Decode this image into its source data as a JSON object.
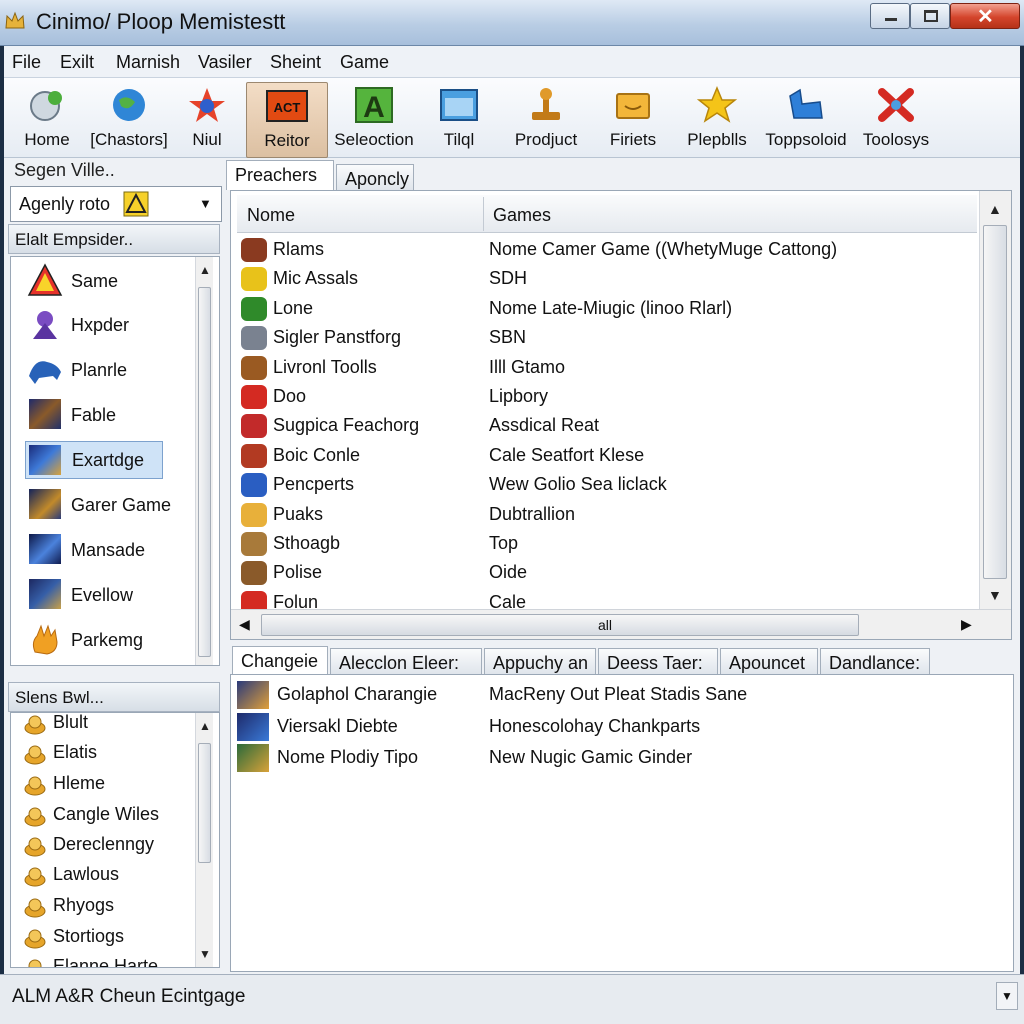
{
  "window": {
    "title": "Cinimo/ Ploop Memistestt"
  },
  "menu": [
    "File",
    "Exilt",
    "Marnish",
    "Vasiler",
    "Sheint",
    "Game"
  ],
  "toolbar": [
    {
      "label": "Home",
      "icon": "home-globe-icon"
    },
    {
      "label": "[Chastors]",
      "icon": "globe-icon"
    },
    {
      "label": "Niul",
      "icon": "puzzle-star-icon"
    },
    {
      "label": "Reitor",
      "icon": "act-icon",
      "active": true
    },
    {
      "label": "Seleoction",
      "icon": "a-letter-icon"
    },
    {
      "label": "Tilql",
      "icon": "window-icon"
    },
    {
      "label": "Prodjuct",
      "icon": "joystick-icon"
    },
    {
      "label": "Firiets",
      "icon": "folder-icon"
    },
    {
      "label": "Plepblls",
      "icon": "star-icon"
    },
    {
      "label": "Toppsoloid",
      "icon": "blue-shape-icon"
    },
    {
      "label": "Toolosys",
      "icon": "red-x-icon"
    }
  ],
  "left": {
    "search_label": "Segen Ville..",
    "dropdown_value": "Agenly roto",
    "section1_title": "Elalt Empsider..",
    "items1": [
      {
        "label": "Same",
        "icon": "warning-icon"
      },
      {
        "label": "Hxpder",
        "icon": "creature-icon"
      },
      {
        "label": "Planrle",
        "icon": "animal-icon"
      },
      {
        "label": "Fable",
        "icon": "game-thumb-icon"
      },
      {
        "label": "Exartdge",
        "icon": "game-thumb-icon",
        "selected": true
      },
      {
        "label": "Garer Game",
        "icon": "game-thumb-icon"
      },
      {
        "label": "Mansade",
        "icon": "game-thumb-icon"
      },
      {
        "label": "Evellow",
        "icon": "game-thumb-icon"
      },
      {
        "label": "Parkemg",
        "icon": "hand-icon"
      }
    ],
    "section2_title": "Slens Bwl...",
    "items2": [
      "Blult",
      "Elatis",
      "Hleme",
      "Cangle Wiles",
      "Dereclenngy",
      "Lawlous",
      "Rhyogs",
      "Stortiogs",
      "Elanne Harte"
    ]
  },
  "top_tabs": [
    "Preachers",
    "Aponcly"
  ],
  "table": {
    "headers": [
      "Nome",
      "Games"
    ],
    "rows": [
      {
        "name": "Rlams",
        "game": "Nome Camer Game ((WhetyMuge Cattong)"
      },
      {
        "name": "Mic Assals",
        "game": "SDH"
      },
      {
        "name": "Lone",
        "game": "Nome Late-Miugic (linoo Rlarl)"
      },
      {
        "name": "Sigler Panstforg",
        "game": "SBN"
      },
      {
        "name": "Livronl Toolls",
        "game": "Illl Gtamo"
      },
      {
        "name": "Doo",
        "game": "Lipbory"
      },
      {
        "name": "Sugpica Feachorg",
        "game": "Assdical Reat"
      },
      {
        "name": "Boic Conle",
        "game": "Cale Seatfort Klese"
      },
      {
        "name": "Pencperts",
        "game": "Wew Golio Sea liclack"
      },
      {
        "name": "Puaks",
        "game": "Dubtrallion"
      },
      {
        "name": "Sthoagb",
        "game": "Top"
      },
      {
        "name": "Polise",
        "game": "Oide"
      },
      {
        "name": "Folun",
        "game": "Cale"
      }
    ],
    "hscroll_label": "all"
  },
  "bottom_tabs": [
    "Changeie",
    "Alecclon Eleer:",
    "Appuchy an",
    "Deess Taer:",
    "Apouncet",
    "Dandlance:"
  ],
  "bottom_rows": [
    {
      "name": "Golaphol Charangie",
      "desc": "MacReny Out Pleat Stadis Sane"
    },
    {
      "name": "Viersakl Diebte",
      "desc": "Honescolohay Chankparts"
    },
    {
      "name": "Nome Plodiy Tipo",
      "desc": "New Nugic Gamic Ginder"
    }
  ],
  "status": "ALM A&R Cheun Ecintgage",
  "colors": {
    "title_bar": "#b9cde4",
    "selected": "#cfe3f7",
    "close": "#d4452c"
  }
}
